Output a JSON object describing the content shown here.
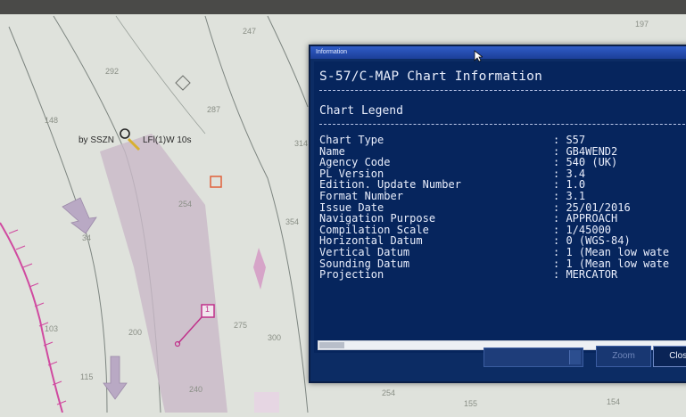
{
  "chart_view": {
    "depth_soundings": [
      "247",
      "292",
      "148",
      "287",
      "254",
      "34",
      "354",
      "314",
      "103",
      "200",
      "275",
      "300",
      "115",
      "240",
      "254",
      "155",
      "154",
      "197"
    ],
    "light_label": "by SSZN",
    "light_characteristic": "LFl(1)W 10s",
    "boxed_symbol": "1"
  },
  "info_window": {
    "title": "Information",
    "heading": "S-57/C-MAP Chart Information",
    "section": "Chart Legend",
    "rows": [
      {
        "label": "Chart Type",
        "value": ": S57"
      },
      {
        "label": "Name",
        "value": ": GB4WEND2"
      },
      {
        "label": "Agency Code",
        "value": ": 540 (UK)"
      },
      {
        "label": "PL Version",
        "value": ": 3.4"
      },
      {
        "label": "Edition. Update Number",
        "value": ": 1.0"
      },
      {
        "label": "Format Number",
        "value": ": 3.1"
      },
      {
        "label": "Issue Date",
        "value": ": 25/01/2016"
      },
      {
        "label": "Navigation Purpose",
        "value": ": APPROACH"
      },
      {
        "label": "Compilation Scale",
        "value": ": 1/45000"
      },
      {
        "label": "Horizontal Datum",
        "value": ": 0 (WGS-84)"
      },
      {
        "label": "Vertical Datum",
        "value": ": 1 (Mean low wate"
      },
      {
        "label": "Sounding Datum",
        "value": ": 1 (Mean low wate"
      },
      {
        "label": "Projection",
        "value": ": MERCATOR"
      }
    ],
    "buttons": {
      "zoom": "Zoom",
      "close": "Close"
    }
  },
  "colors": {
    "window_bg": "#06255d",
    "titlebar": "#2f5cc7",
    "chart_bg": "#dfe2dc",
    "fairway": "#c9b9c8",
    "magenta": "#d04aa0"
  }
}
